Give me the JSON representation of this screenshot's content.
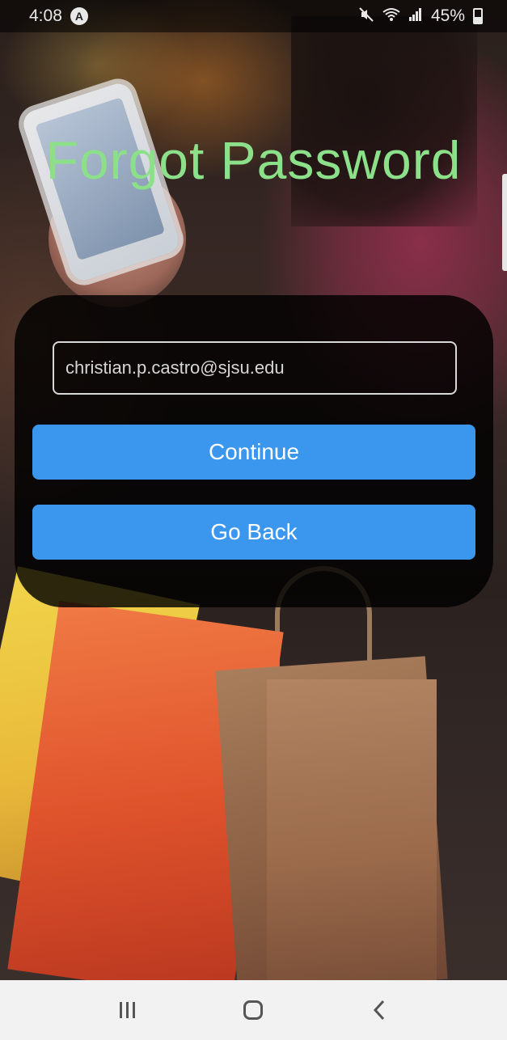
{
  "status_bar": {
    "time": "4:08",
    "app_badge": "A",
    "battery_percent": "45%",
    "icons": [
      "mute-icon",
      "wifi-icon",
      "signal-icon",
      "battery-icon"
    ]
  },
  "page": {
    "title": "Forgot Password"
  },
  "form": {
    "email_value": "christian.p.castro@sjsu.edu",
    "continue_label": "Continue",
    "go_back_label": "Go Back"
  },
  "navigation_bar": {
    "buttons": [
      "recents-icon",
      "home-icon",
      "back-icon"
    ]
  },
  "colors": {
    "title": "#8ce08a",
    "button": "#3b97ee",
    "card": "#000000"
  }
}
